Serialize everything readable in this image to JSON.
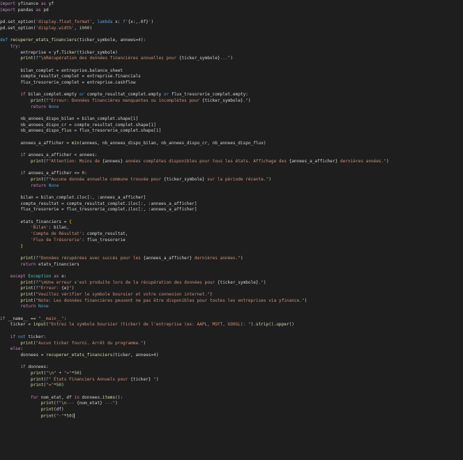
{
  "editor": {
    "language": "python",
    "colors": {
      "background": "#1e1e1e",
      "keyword": "#c586c0",
      "builtin": "#569cd6",
      "function": "#dcdcaa",
      "string": "#ce9178",
      "number": "#b5cea8",
      "variable": "#9cdcfe",
      "class": "#4ec9b0",
      "escape": "#d7ba7d",
      "punctuation": "#ffd700",
      "text": "#d4d4d4"
    },
    "lines": [
      [
        [
          "kw",
          "import"
        ],
        [
          "tx",
          " yfinance "
        ],
        [
          "kw",
          "as"
        ],
        [
          "tx",
          " yf"
        ]
      ],
      [
        [
          "kw",
          "import"
        ],
        [
          "tx",
          " pandas "
        ],
        [
          "kw",
          "as"
        ],
        [
          "tx",
          " pd"
        ]
      ],
      [],
      [
        [
          "tx",
          "pd.set_option("
        ],
        [
          "st",
          "'display.float_format'"
        ],
        [
          "tx",
          ", "
        ],
        [
          "bl",
          "lambda"
        ],
        [
          "tx",
          " x: "
        ],
        [
          "bl",
          "f"
        ],
        [
          "st",
          "'"
        ],
        [
          "tx",
          "{x:,.0f}"
        ],
        [
          "st",
          "'"
        ],
        [
          "tx",
          ")"
        ]
      ],
      [
        [
          "tx",
          "pd.set_option("
        ],
        [
          "st",
          "'display.width'"
        ],
        [
          "tx",
          ", "
        ],
        [
          "nm",
          "1000"
        ],
        [
          "tx",
          ")"
        ]
      ],
      [],
      [
        [
          "bl",
          "def"
        ],
        [
          "tx",
          " "
        ],
        [
          "fn",
          "recuperer_etats_financiers"
        ],
        [
          "tx",
          "(ticker_symbole, annees="
        ],
        [
          "nm",
          "4"
        ],
        [
          "tx",
          "):"
        ]
      ],
      [
        [
          "tx",
          "    "
        ],
        [
          "kw",
          "try"
        ],
        [
          "tx",
          ":"
        ]
      ],
      [
        [
          "tx",
          "        entreprise = yf."
        ],
        [
          "fn",
          "Ticker"
        ],
        [
          "tx",
          "(ticker_symbole)"
        ]
      ],
      [
        [
          "tx",
          "        "
        ],
        [
          "fn",
          "print"
        ],
        [
          "tx",
          "("
        ],
        [
          "bl",
          "f"
        ],
        [
          "st",
          "\""
        ],
        [
          "es",
          "\\n"
        ],
        [
          "st",
          "Récupération des données financières annuelles pour "
        ],
        [
          "tx",
          "{ticker_symbole}"
        ],
        [
          "st",
          "...\""
        ],
        [
          "tx",
          ")"
        ]
      ],
      [],
      [
        [
          "tx",
          "        bilan_complet = entreprise.balance_sheet"
        ]
      ],
      [
        [
          "tx",
          "        compte_resultat_complet = entreprise.financials"
        ]
      ],
      [
        [
          "tx",
          "        flux_tresorerie_complet = entreprise.cashflow"
        ]
      ],
      [],
      [
        [
          "tx",
          "        "
        ],
        [
          "kw",
          "if"
        ],
        [
          "tx",
          " bilan_complet.empty "
        ],
        [
          "bl",
          "or"
        ],
        [
          "tx",
          " compte_resultat_complet.empty "
        ],
        [
          "bl",
          "or"
        ],
        [
          "tx",
          " flux_tresorerie_complet.empty:"
        ]
      ],
      [
        [
          "tx",
          "            "
        ],
        [
          "fn",
          "print"
        ],
        [
          "tx",
          "("
        ],
        [
          "bl",
          "f"
        ],
        [
          "st",
          "\"Erreur: Données financières manquantes ou incomplètes pour "
        ],
        [
          "tx",
          "{ticker_symbole}"
        ],
        [
          "st",
          ".\""
        ],
        [
          "tx",
          ")"
        ]
      ],
      [
        [
          "tx",
          "            "
        ],
        [
          "kw",
          "return"
        ],
        [
          "tx",
          " "
        ],
        [
          "bl",
          "None"
        ]
      ],
      [],
      [
        [
          "tx",
          "        nb_annees_dispo_bilan = bilan_complet.shape["
        ],
        [
          "nm",
          "1"
        ],
        [
          "tx",
          "]"
        ]
      ],
      [
        [
          "tx",
          "        nb_annees_dispo_cr = compte_resultat_complet.shape["
        ],
        [
          "nm",
          "1"
        ],
        [
          "tx",
          "]"
        ]
      ],
      [
        [
          "tx",
          "        nb_annees_dispo_flux = flux_tresorerie_complet.shape["
        ],
        [
          "nm",
          "1"
        ],
        [
          "tx",
          "]"
        ]
      ],
      [],
      [
        [
          "tx",
          "        annees_a_afficher = "
        ],
        [
          "fn",
          "min"
        ],
        [
          "tx",
          "(annees, nb_annees_dispo_bilan, nb_annees_dispo_cr, nb_annees_dispo_flux)"
        ]
      ],
      [],
      [
        [
          "tx",
          "        "
        ],
        [
          "kw",
          "if"
        ],
        [
          "tx",
          " annees_a_afficher < annees:"
        ]
      ],
      [
        [
          "tx",
          "            "
        ],
        [
          "fn",
          "print"
        ],
        [
          "tx",
          "("
        ],
        [
          "bl",
          "f"
        ],
        [
          "st",
          "\"Attention: Moins de "
        ],
        [
          "tx",
          "{annees}"
        ],
        [
          "st",
          " années complètes disponibles pour tous les états. Affichage des "
        ],
        [
          "tx",
          "{annees_a_afficher}"
        ],
        [
          "st",
          " dernières années.\""
        ],
        [
          "tx",
          ")"
        ]
      ],
      [],
      [
        [
          "tx",
          "        "
        ],
        [
          "kw",
          "if"
        ],
        [
          "tx",
          " annees_a_afficher <= "
        ],
        [
          "nm",
          "0"
        ],
        [
          "tx",
          ":"
        ]
      ],
      [
        [
          "tx",
          "            "
        ],
        [
          "fn",
          "print"
        ],
        [
          "tx",
          "("
        ],
        [
          "bl",
          "f"
        ],
        [
          "st",
          "\"Aucune donnée annuelle commune trouvée pour "
        ],
        [
          "tx",
          "{ticker_symbole}"
        ],
        [
          "st",
          " sur la période récente.\""
        ],
        [
          "tx",
          ")"
        ]
      ],
      [
        [
          "tx",
          "            "
        ],
        [
          "kw",
          "return"
        ],
        [
          "tx",
          " "
        ],
        [
          "bl",
          "None"
        ]
      ],
      [],
      [
        [
          "tx",
          "        bilan = bilan_complet.iloc[:, :annees_a_afficher]"
        ]
      ],
      [
        [
          "tx",
          "        compte_resultat = compte_resultat_complet.iloc[:, :annees_a_afficher]"
        ]
      ],
      [
        [
          "tx",
          "        flux_tresorerie = flux_tresorerie_complet.iloc[:, :annees_a_afficher]"
        ]
      ],
      [],
      [
        [
          "tx",
          "        etats_financiers = "
        ],
        [
          "pn",
          "{"
        ]
      ],
      [
        [
          "tx",
          "            "
        ],
        [
          "st",
          "'Bilan'"
        ],
        [
          "tx",
          ": bilan,"
        ]
      ],
      [
        [
          "tx",
          "            "
        ],
        [
          "st",
          "'Compte de Résultat'"
        ],
        [
          "tx",
          ": compte_resultat,"
        ]
      ],
      [
        [
          "tx",
          "            "
        ],
        [
          "st",
          "'Flux de Trésorerie'"
        ],
        [
          "tx",
          ": flux_tresorerie"
        ]
      ],
      [
        [
          "tx",
          "        "
        ],
        [
          "pn",
          "}"
        ]
      ],
      [],
      [
        [
          "tx",
          "        "
        ],
        [
          "fn",
          "print"
        ],
        [
          "tx",
          "("
        ],
        [
          "bl",
          "f"
        ],
        [
          "st",
          "\"Données récupérées avec succès pour les "
        ],
        [
          "tx",
          "{annees_a_afficher}"
        ],
        [
          "st",
          " dernières années.\""
        ],
        [
          "tx",
          ")"
        ]
      ],
      [
        [
          "tx",
          "        "
        ],
        [
          "kw",
          "return"
        ],
        [
          "tx",
          " etats_financiers"
        ]
      ],
      [],
      [
        [
          "tx",
          "    "
        ],
        [
          "kw",
          "except"
        ],
        [
          "tx",
          " "
        ],
        [
          "cl",
          "Exception"
        ],
        [
          "tx",
          " "
        ],
        [
          "kw",
          "as"
        ],
        [
          "tx",
          " e:"
        ]
      ],
      [
        [
          "tx",
          "        "
        ],
        [
          "fn",
          "print"
        ],
        [
          "tx",
          "("
        ],
        [
          "bl",
          "f"
        ],
        [
          "st",
          "\""
        ],
        [
          "es",
          "\\n"
        ],
        [
          "st",
          "Une erreur s'est produite lors de la récupération des données pour "
        ],
        [
          "tx",
          "{ticker_symbole}"
        ],
        [
          "st",
          ".\""
        ],
        [
          "tx",
          ")"
        ]
      ],
      [
        [
          "tx",
          "        "
        ],
        [
          "fn",
          "print"
        ],
        [
          "tx",
          "("
        ],
        [
          "bl",
          "f"
        ],
        [
          "st",
          "\"Erreur: "
        ],
        [
          "tx",
          "{e}"
        ],
        [
          "st",
          "\""
        ],
        [
          "tx",
          ")"
        ]
      ],
      [
        [
          "tx",
          "        "
        ],
        [
          "fn",
          "print"
        ],
        [
          "tx",
          "("
        ],
        [
          "st",
          "\"Veuillez vérifier le symbole boursier et votre connexion internet.\""
        ],
        [
          "tx",
          ")"
        ]
      ],
      [
        [
          "tx",
          "        "
        ],
        [
          "fn",
          "print"
        ],
        [
          "tx",
          "("
        ],
        [
          "st",
          "\"Note: Les données financières peuvent ne pas être disponibles pour toutes les entreprises via yfinance.\""
        ],
        [
          "tx",
          ")"
        ]
      ],
      [
        [
          "tx",
          "        "
        ],
        [
          "kw",
          "return"
        ],
        [
          "tx",
          " "
        ],
        [
          "bl",
          "None"
        ]
      ],
      [],
      [
        [
          "kw",
          "if"
        ],
        [
          "tx",
          " __name__ == "
        ],
        [
          "st",
          "\"__main__\""
        ],
        [
          "tx",
          ":"
        ]
      ],
      [
        [
          "tx",
          "    ticker = "
        ],
        [
          "fn",
          "input"
        ],
        [
          "tx",
          "("
        ],
        [
          "st",
          "\"Entrez le symbole boursier (ticker) de l'entreprise (ex: AAPL, MSFT, GOOGL): \""
        ],
        [
          "tx",
          ")."
        ],
        [
          "fn",
          "strip"
        ],
        [
          "tx",
          "()."
        ],
        [
          "fn",
          "upper"
        ],
        [
          "tx",
          "()"
        ]
      ],
      [],
      [
        [
          "tx",
          "    "
        ],
        [
          "kw",
          "if"
        ],
        [
          "tx",
          " "
        ],
        [
          "bl",
          "not"
        ],
        [
          "tx",
          " ticker:"
        ]
      ],
      [
        [
          "tx",
          "        "
        ],
        [
          "fn",
          "print"
        ],
        [
          "tx",
          "("
        ],
        [
          "st",
          "\"Aucun ticker fourni. Arrêt du programme.\""
        ],
        [
          "tx",
          ")"
        ]
      ],
      [
        [
          "tx",
          "    "
        ],
        [
          "kw",
          "else"
        ],
        [
          "tx",
          ":"
        ]
      ],
      [
        [
          "tx",
          "        donnees = "
        ],
        [
          "fn",
          "recuperer_etats_financiers"
        ],
        [
          "tx",
          "(ticker, annees="
        ],
        [
          "nm",
          "4"
        ],
        [
          "tx",
          ")"
        ]
      ],
      [],
      [
        [
          "tx",
          "        "
        ],
        [
          "kw",
          "if"
        ],
        [
          "tx",
          " donnees:"
        ]
      ],
      [
        [
          "tx",
          "            "
        ],
        [
          "fn",
          "print"
        ],
        [
          "tx",
          "("
        ],
        [
          "st",
          "\""
        ],
        [
          "es",
          "\\n"
        ],
        [
          "st",
          "\""
        ],
        [
          "tx",
          " + "
        ],
        [
          "st",
          "\"=\""
        ],
        [
          "tx",
          "*"
        ],
        [
          "nm",
          "50"
        ],
        [
          "tx",
          ")"
        ]
      ],
      [
        [
          "tx",
          "            "
        ],
        [
          "fn",
          "print"
        ],
        [
          "tx",
          "("
        ],
        [
          "bl",
          "f"
        ],
        [
          "st",
          "\" États Financiers Annuels pour "
        ],
        [
          "tx",
          "{ticker}"
        ],
        [
          "st",
          " \""
        ],
        [
          "tx",
          ")"
        ]
      ],
      [
        [
          "tx",
          "            "
        ],
        [
          "fn",
          "print"
        ],
        [
          "tx",
          "("
        ],
        [
          "st",
          "\"=\""
        ],
        [
          "tx",
          "*"
        ],
        [
          "nm",
          "50"
        ],
        [
          "tx",
          ")"
        ]
      ],
      [],
      [
        [
          "tx",
          "            "
        ],
        [
          "kw",
          "for"
        ],
        [
          "tx",
          " nom_etat, df "
        ],
        [
          "kw",
          "in"
        ],
        [
          "tx",
          " donnees."
        ],
        [
          "fn",
          "items"
        ],
        [
          "tx",
          "():"
        ]
      ],
      [
        [
          "tx",
          "                "
        ],
        [
          "fn",
          "print"
        ],
        [
          "tx",
          "("
        ],
        [
          "bl",
          "f"
        ],
        [
          "st",
          "\""
        ],
        [
          "es",
          "\\n"
        ],
        [
          "st",
          "--- "
        ],
        [
          "tx",
          "{nom_etat}"
        ],
        [
          "st",
          " ---\""
        ],
        [
          "tx",
          ")"
        ]
      ],
      [
        [
          "tx",
          "                "
        ],
        [
          "fn",
          "print"
        ],
        [
          "tx",
          "(df)"
        ]
      ],
      [
        [
          "tx",
          "                "
        ],
        [
          "fn",
          "print"
        ],
        [
          "tx",
          "("
        ],
        [
          "st",
          "\"-\""
        ],
        [
          "tx",
          "*"
        ],
        [
          "nm",
          "50"
        ],
        [
          "tx",
          ")"
        ],
        [
          "cursor",
          ""
        ]
      ]
    ]
  }
}
